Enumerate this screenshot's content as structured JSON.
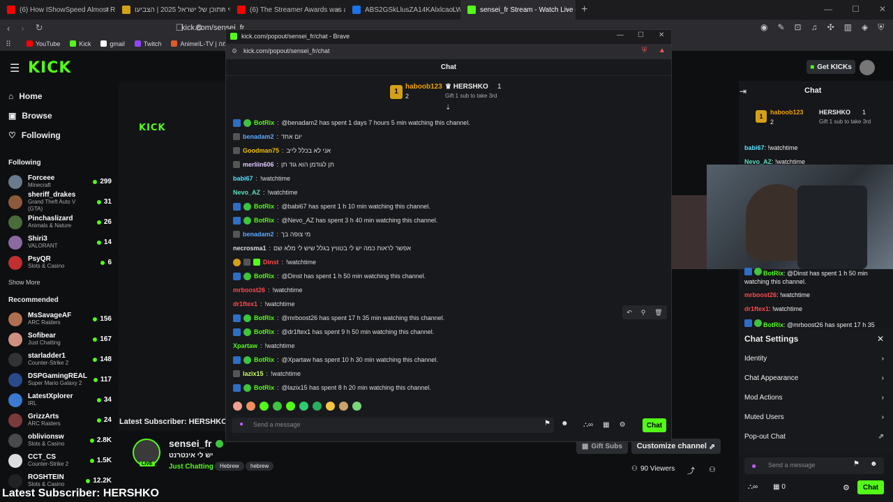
{
  "browser": {
    "tabs": [
      {
        "title": "(6) How IShowSpeed Almost Ruined",
        "color": "#ff0000"
      },
      {
        "title": "פרסי התוכן של ישראל 2025 | הצביעו",
        "color": "#d4a017"
      },
      {
        "title": "(6) The Streamer Awards was a Disast",
        "color": "#ff0000"
      },
      {
        "title": "ABS2GSkLlusZA14KAlxlcacLWd87EfY",
        "color": "#1a73e8"
      },
      {
        "title": "sensei_fr Stream - Watch Live on",
        "color": "#53fc18"
      }
    ],
    "url": "kick.com/sensei_fr",
    "bookmarks": [
      "YouTube",
      "Kick",
      "gmail",
      "Twitch",
      "AnimeIL-TV | אנימה..."
    ]
  },
  "site": {
    "get_kicks": "Get KICKs",
    "nav": [
      "Home",
      "Browse",
      "Following"
    ],
    "following_title": "Following",
    "following": [
      {
        "name": "Forceee",
        "game": "Minecraft",
        "viewers": "299"
      },
      {
        "name": "sheriff_drakes",
        "game": "Grand Theft Auto V (GTA)",
        "viewers": "31"
      },
      {
        "name": "Pinchaslizard",
        "game": "Animals & Nature",
        "viewers": "26"
      },
      {
        "name": "Shiri3",
        "game": "VALORANT",
        "viewers": "14"
      },
      {
        "name": "PsyQR",
        "game": "Slots & Casino",
        "viewers": "6"
      }
    ],
    "show_more": "Show More",
    "recommended_title": "Recommended",
    "recommended": [
      {
        "name": "MsSavageAF",
        "game": "ARC Raiders",
        "viewers": "156"
      },
      {
        "name": "Sofibear",
        "game": "Just Chatting",
        "viewers": "167"
      },
      {
        "name": "starladder1",
        "game": "Counter-Strike 2",
        "viewers": "148"
      },
      {
        "name": "DSPGamingREAL",
        "game": "Super Mario Galaxy 2",
        "viewers": "117"
      },
      {
        "name": "LatestXplorer",
        "game": "IRL",
        "viewers": "34"
      },
      {
        "name": "GrizzArts",
        "game": "ARC Raiders",
        "viewers": "24"
      },
      {
        "name": "oblivionsw",
        "game": "Slots & Casino",
        "viewers": "2.8K"
      },
      {
        "name": "CCT_CS",
        "game": "Counter-Strike 2",
        "viewers": "1.5K"
      },
      {
        "name": "ROSHTEIN",
        "game": "Slots & Casino",
        "viewers": "12.2K"
      }
    ],
    "latest_sub": "Latest Subscriber: HERSHKO",
    "streamer": {
      "name": "sensei_fr",
      "title": "יש לי אינטרנט",
      "category": "Just Chatting",
      "tags": [
        "Hebrew",
        "hebrew"
      ],
      "live": "LIVE"
    },
    "gift_subs": "Gift Subs",
    "customize": "Customize channel",
    "viewers": "90 Viewers"
  },
  "popup": {
    "window_title": "kick.com/popout/sensei_fr/chat - Brave",
    "url": "kick.com/popout/sensei_fr/chat",
    "header": "Chat",
    "leader1": {
      "name": "haboob123",
      "count": "2"
    },
    "leader2": {
      "name": "HERSHKO",
      "count": "1",
      "note": "Gift 1 sub to take 3rd"
    },
    "messages": [
      {
        "user": "BotRix",
        "color": "#53fc18",
        "badges": "bot",
        "text": "@benadam2 has spent 1 days 7 hours 5 min watching this channel."
      },
      {
        "user": "benadam2",
        "color": "#5aa9ff",
        "badges": "sub",
        "text": "יום אחד"
      },
      {
        "user": "Goodman75",
        "color": "#f0c000",
        "badges": "sub",
        "text": "אני לא בכלל לייב"
      },
      {
        "user": "merliin606",
        "color": "#e0c8ff",
        "badges": "sub",
        "text": "תן לגודמן הוא גוד תן"
      },
      {
        "user": "babi67",
        "color": "#5ae0ff",
        "badges": "",
        "text": "!watchtime"
      },
      {
        "user": "Nevo_AZ",
        "color": "#5ae0c0",
        "badges": "",
        "text": "!watchtime"
      },
      {
        "user": "BotRix",
        "color": "#53fc18",
        "badges": "bot",
        "text": "@babi67 has spent 1 h 10 min watching this channel."
      },
      {
        "user": "BotRix",
        "color": "#53fc18",
        "badges": "bot",
        "text": "@Nevo_AZ has spent 3 h 40 min watching this channel."
      },
      {
        "user": "benadam2",
        "color": "#5aa9ff",
        "badges": "sub",
        "text": "מי צופה בך"
      },
      {
        "user": "necrosma1",
        "color": "#dddddd",
        "badges": "",
        "text": "אפשר לראות כמה יש לי בטוויץ בגלל שיש לי מלא שם"
      },
      {
        "user": "Dinst",
        "color": "#ff4a4a",
        "badges": "gold",
        "text": "!watchtime"
      },
      {
        "user": "BotRix",
        "color": "#53fc18",
        "badges": "bot",
        "text": "@Dinst has spent 1 h 50 min watching this channel."
      },
      {
        "user": "mrboost26",
        "color": "#ff4a4a",
        "badges": "",
        "text": "!watchtime"
      },
      {
        "user": "dr1ftex1",
        "color": "#ff4a4a",
        "badges": "",
        "text": "!watchtime"
      },
      {
        "user": "BotRix",
        "color": "#53fc18",
        "badges": "bot",
        "text": "@mrboost26 has spent 17 h 35 min watching this channel."
      },
      {
        "user": "BotRix",
        "color": "#53fc18",
        "badges": "bot",
        "text": "@dr1ftex1 has spent 9 h 50 min watching this channel."
      },
      {
        "user": "Xpartaw",
        "color": "#53fc18",
        "badges": "",
        "text": "!watchtime"
      },
      {
        "user": "BotRix",
        "color": "#53fc18",
        "badges": "bot",
        "text": "@Xpartaw has spent 10 h 30 min watching this channel."
      },
      {
        "user": "lazix15",
        "color": "#c8ff5a",
        "badges": "sub",
        "text": "!watchtime"
      },
      {
        "user": "BotRix",
        "color": "#53fc18",
        "badges": "bot",
        "text": "@lazix15 has spent 8 h 20 min watching this channel."
      }
    ],
    "placeholder": "Send a message",
    "chat_button": "Chat"
  },
  "right_chat": {
    "header": "Chat",
    "leader1": {
      "name": "haboob123",
      "count": "2"
    },
    "leader2": {
      "name": "HERSHKO",
      "count": "1",
      "note": "Gift 1 sub to take 3rd"
    },
    "messages": [
      {
        "user": "babi67",
        "color": "#5ae0ff",
        "text": "!watchtime"
      },
      {
        "user": "Nevo_AZ",
        "color": "#5ae0c0",
        "text": "!watchtime"
      }
    ],
    "bot_line1": "@Dinst has spent 1 h 50 min",
    "bot_line1b": "watching this channel.",
    "mid_messages": [
      {
        "user": "mrboost26",
        "color": "#ff4a4a",
        "text": "!watchtime"
      },
      {
        "user": "dr1ftex1",
        "color": "#ff4a4a",
        "text": "!watchtime"
      }
    ],
    "bot_line2": "@mrboost26 has spent 17 h 35",
    "settings_title": "Chat Settings",
    "settings": [
      "Identity",
      "Chat Appearance",
      "Mod Actions",
      "Muted Users",
      "Pop-out Chat"
    ],
    "placeholder": "Send a message",
    "chat_button": "Chat",
    "count": "0"
  }
}
